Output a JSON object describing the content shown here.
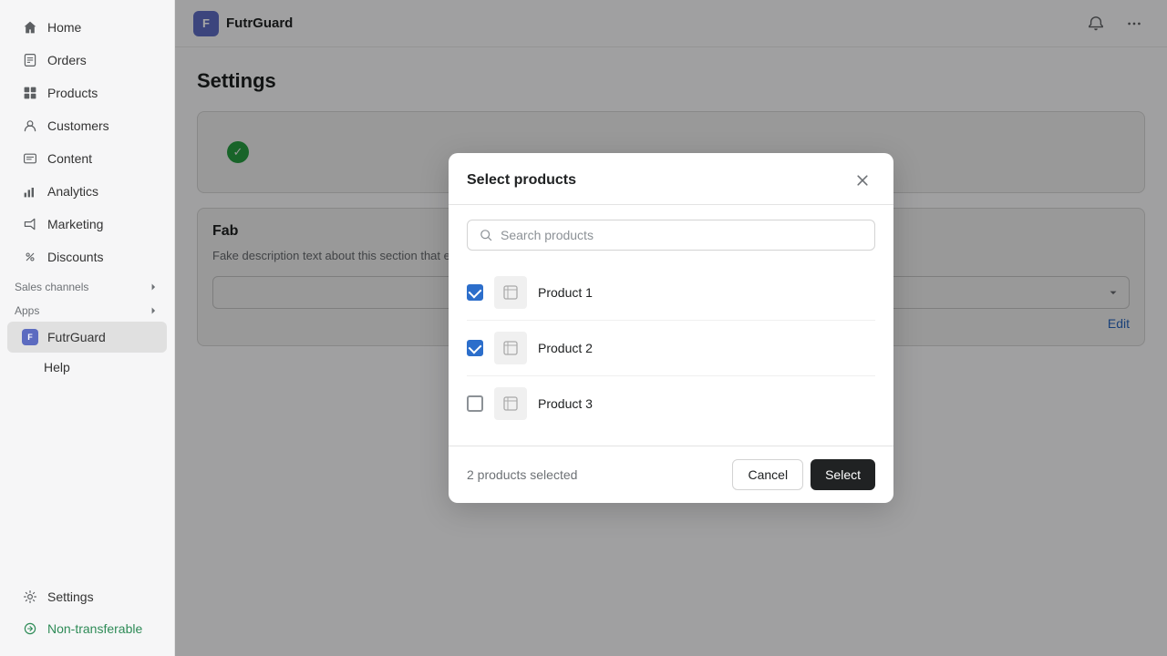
{
  "brand": {
    "name": "FutrGuard",
    "icon_letter": "F"
  },
  "sidebar": {
    "nav_items": [
      {
        "id": "home",
        "label": "Home",
        "icon": "home"
      },
      {
        "id": "orders",
        "label": "Orders",
        "icon": "orders"
      },
      {
        "id": "products",
        "label": "Products",
        "icon": "products"
      },
      {
        "id": "customers",
        "label": "Customers",
        "icon": "customers"
      },
      {
        "id": "content",
        "label": "Content",
        "icon": "content"
      },
      {
        "id": "analytics",
        "label": "Analytics",
        "icon": "analytics"
      },
      {
        "id": "marketing",
        "label": "Marketing",
        "icon": "marketing"
      },
      {
        "id": "discounts",
        "label": "Discounts",
        "icon": "discounts"
      }
    ],
    "sales_channels_label": "Sales channels",
    "apps_label": "Apps",
    "apps_items": [
      {
        "id": "futrguard",
        "label": "FutrGuard"
      },
      {
        "id": "help",
        "label": "Help"
      }
    ],
    "bottom_items": [
      {
        "id": "settings",
        "label": "Settings"
      },
      {
        "id": "non-transferable",
        "label": "Non-transferable"
      }
    ]
  },
  "page": {
    "title": "Settings",
    "fab_section_title": "Fab",
    "fab_description": "Fake description text about this section that explains functionality and usage. You can configure various options here.",
    "edit_link": "Edit"
  },
  "modal": {
    "title": "Select products",
    "search_placeholder": "Search products",
    "products": [
      {
        "id": 1,
        "name": "Product 1",
        "checked": true
      },
      {
        "id": 2,
        "name": "Product 2",
        "checked": true
      },
      {
        "id": 3,
        "name": "Product 3",
        "checked": false
      }
    ],
    "selected_count_label": "2 products selected",
    "cancel_label": "Cancel",
    "select_label": "Select"
  }
}
